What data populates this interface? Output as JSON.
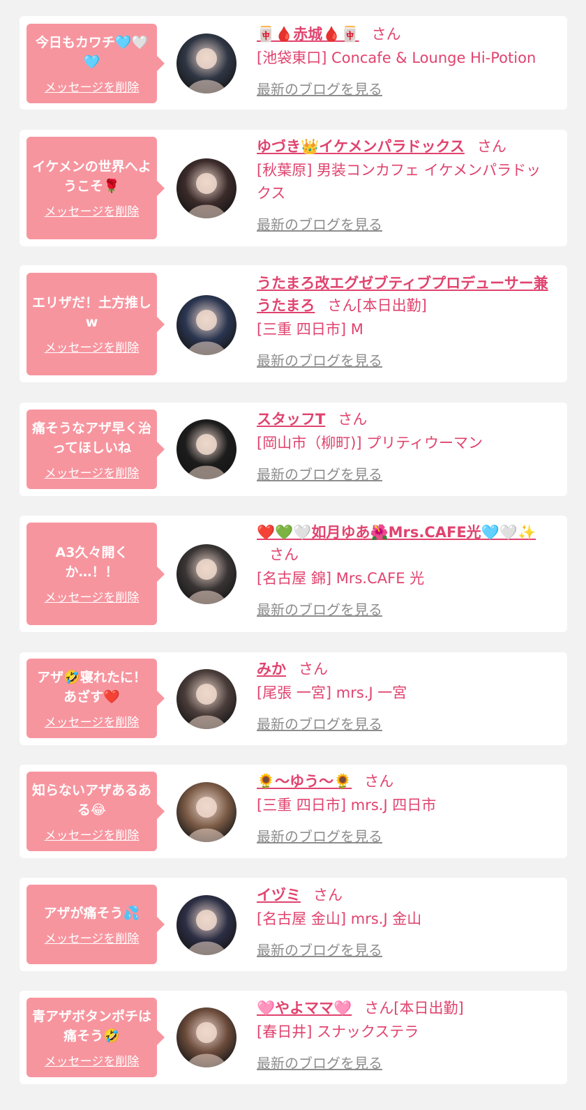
{
  "common": {
    "delete_label": "メッセージを削除",
    "blog_label": "最新のブログを見る",
    "honorific": "さん"
  },
  "colors": {
    "background": "#f2f2f3",
    "card": "#ffffff",
    "bubble": "#f7959f",
    "accent": "#e0436e",
    "link_gray": "#8d8d8d"
  },
  "items": [
    {
      "message": "今日もカワチ🩵🤍🩵",
      "name": "🀄🩸赤城🩸🀄",
      "status": "",
      "shop": "[池袋東口] Concafe & Lounge Hi-Potion",
      "avatar_icon": "avatar-photo",
      "avatar_color": "#2f3644"
    },
    {
      "message": "イケメンの世界へようこそ🌹",
      "name": "ゆづき👑イケメンパラドックス",
      "status": "",
      "shop": "[秋葉原] 男装コンカフェ イケメンパラドックス",
      "avatar_icon": "avatar-photo",
      "avatar_color": "#3b2b2a"
    },
    {
      "message": "エリザだ！土方推しw",
      "name": "うたまろ改エグゼブティブプロデューサー兼うたまろ",
      "status": "[本日出勤]",
      "shop": "[三重 四日市] M",
      "avatar_icon": "avatar-photo",
      "avatar_color": "#2a3550"
    },
    {
      "message": "痛そうなアザ早く治ってほしいね",
      "name": "スタッフT",
      "status": "",
      "shop": "[岡山市（柳町)] プリティウーマン",
      "avatar_icon": "avatar-photo",
      "avatar_color": "#1c1c1c"
    },
    {
      "message": "A3久々開くか…！！",
      "name": "❤️💚🤍如月ゆあ🌺Mrs.CAFE光🩵🤍✨",
      "status": "",
      "shop": "[名古屋 錦] Mrs.CAFE 光",
      "avatar_icon": "avatar-photo",
      "avatar_color": "#3a3535"
    },
    {
      "message": "アザ🤣寝れたに！あざす❤️",
      "name": "みか",
      "status": "",
      "shop": "[尾張 一宮] mrs.J 一宮",
      "avatar_icon": "avatar-photo",
      "avatar_color": "#4a3d3a"
    },
    {
      "message": "知らないアザあるある😂",
      "name": "🌻～ゆう～🌻",
      "status": "",
      "shop": "[三重 四日市] mrs.J 四日市",
      "avatar_icon": "avatar-photo",
      "avatar_color": "#7a5a45"
    },
    {
      "message": "アザが痛そう💦",
      "name": "イヅミ",
      "status": "",
      "shop": "[名古屋 金山] mrs.J 金山",
      "avatar_icon": "avatar-photo",
      "avatar_color": "#2c2e44"
    },
    {
      "message": "青アザボタンポチは痛そう🤣",
      "name": "🩷やよママ🩷",
      "status": "[本日出勤]",
      "shop": "[春日井] スナックステラ",
      "avatar_icon": "avatar-photo",
      "avatar_color": "#6a4a3a"
    }
  ]
}
